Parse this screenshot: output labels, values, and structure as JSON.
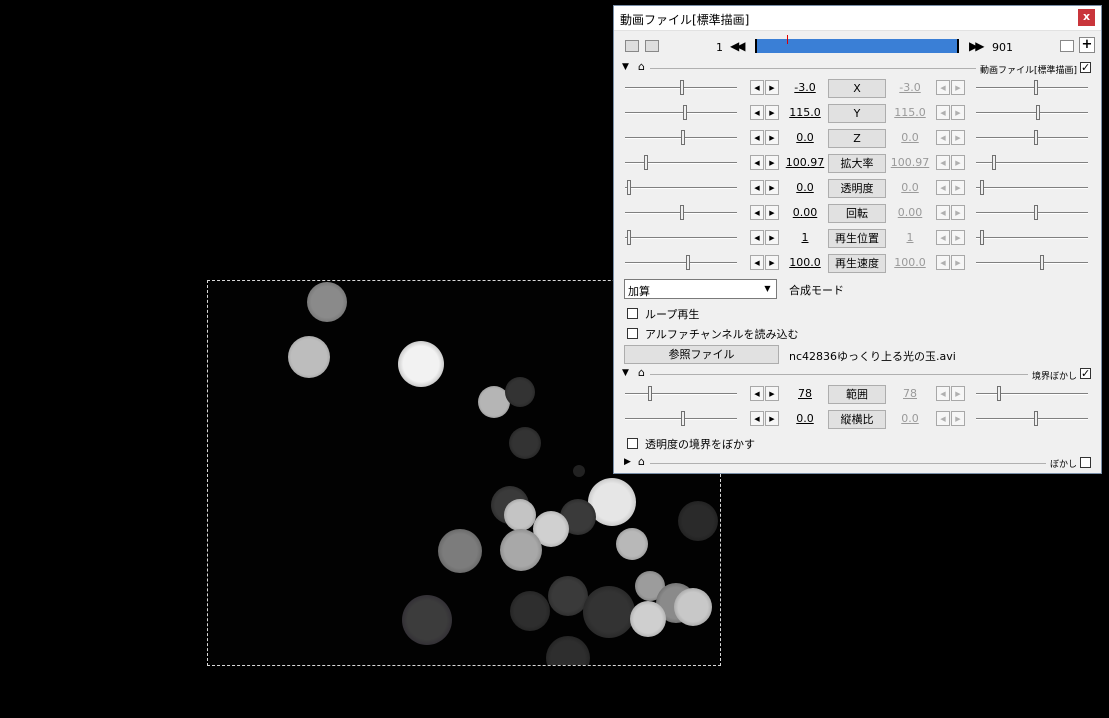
{
  "window": {
    "title": "動画ファイル[標準描画]",
    "close_label": "x"
  },
  "timeline": {
    "start_frame": "1",
    "end_frame": "901",
    "add_label": "+",
    "position_fraction": 0.15
  },
  "sections": {
    "video": "動画ファイル[標準描画]",
    "border_blur": "境界ぼかし",
    "blur": "ぼかし"
  },
  "params": [
    {
      "label": "X",
      "left": "-3.0",
      "right": "-3.0",
      "left_pos": 0.52,
      "right_pos": 0.55
    },
    {
      "label": "Y",
      "left": "115.0",
      "right": "115.0",
      "left_pos": 0.55,
      "right_pos": 0.57
    },
    {
      "label": "Z",
      "left": "0.0",
      "right": "0.0",
      "left_pos": 0.53,
      "right_pos": 0.55
    },
    {
      "label": "拡大率",
      "left": "100.97",
      "right": "100.97",
      "left_pos": 0.18,
      "right_pos": 0.15
    },
    {
      "label": "透明度",
      "left": "0.0",
      "right": "0.0",
      "left_pos": 0.02,
      "right_pos": 0.04
    },
    {
      "label": "回転",
      "left": "0.00",
      "right": "0.00",
      "left_pos": 0.52,
      "right_pos": 0.55
    },
    {
      "label": "再生位置",
      "left": "1",
      "right": "1",
      "left_pos": 0.02,
      "right_pos": 0.04
    },
    {
      "label": "再生速度",
      "left": "100.0",
      "right": "100.0",
      "left_pos": 0.58,
      "right_pos": 0.6
    }
  ],
  "blend": {
    "selected": "加算",
    "label": "合成モード"
  },
  "options": {
    "loop_label": "ループ再生",
    "alpha_label": "アルファチャンネルを読み込む",
    "ref_button": "参照ファイル",
    "file_name": "nc42836ゆっくり上る光の玉.avi"
  },
  "blur_params": [
    {
      "label": "範囲",
      "left": "78",
      "right": "78",
      "left_pos": 0.22,
      "right_pos": 0.2
    },
    {
      "label": "縦横比",
      "left": "0.0",
      "right": "0.0",
      "left_pos": 0.53,
      "right_pos": 0.55
    }
  ],
  "blur_options": {
    "transparent_edge_label": "透明度の境界をぼかす"
  },
  "colors": {
    "timeline_fill": "#3a7fd6",
    "close_button": "#c9353b"
  }
}
